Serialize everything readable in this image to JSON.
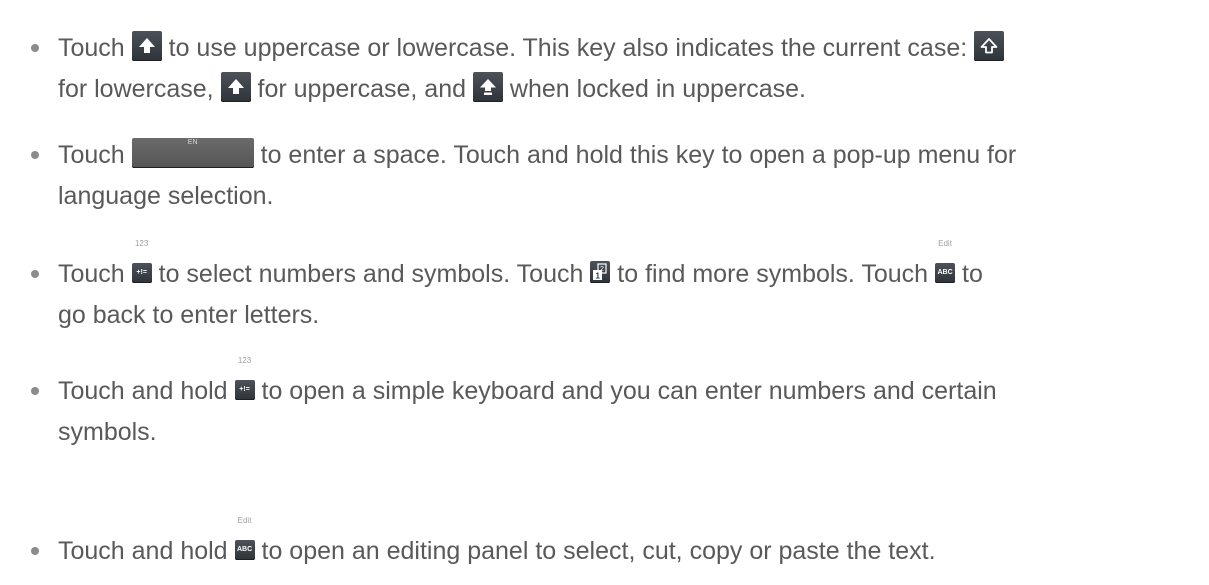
{
  "bullets": [
    {
      "l1a": "Touch",
      "l1b": "to use uppercase or lowercase. This key also indicates the current case:",
      "l2a": "for lowercase,",
      "l2b": "for uppercase, and",
      "l2c": "when locked in uppercase."
    },
    {
      "l1a": "Touch",
      "space_caption": "EN",
      "l1b": "to enter a space. Touch and hold this key to open a pop-up menu for",
      "l2": "language selection."
    },
    {
      "l1a": "Touch",
      "key1_top": "123",
      "key1_face": "+!=",
      "l1b": "to select numbers and symbols. Touch",
      "l1c": "to find more symbols. Touch",
      "key3_top": "Edit",
      "key3_face": "ABC",
      "l1d": "to",
      "l2": "go back to enter letters."
    },
    {
      "l1a": "Touch and hold",
      "key_top": "123",
      "key_face": "+!=",
      "l1b": "to open a simple keyboard and you can enter numbers and certain",
      "l2": "symbols."
    },
    {
      "l1a": "Touch and hold",
      "key_top": "Edit",
      "key_face": "ABC",
      "l1b": "to open an editing panel to select, cut, copy or paste the text."
    }
  ]
}
